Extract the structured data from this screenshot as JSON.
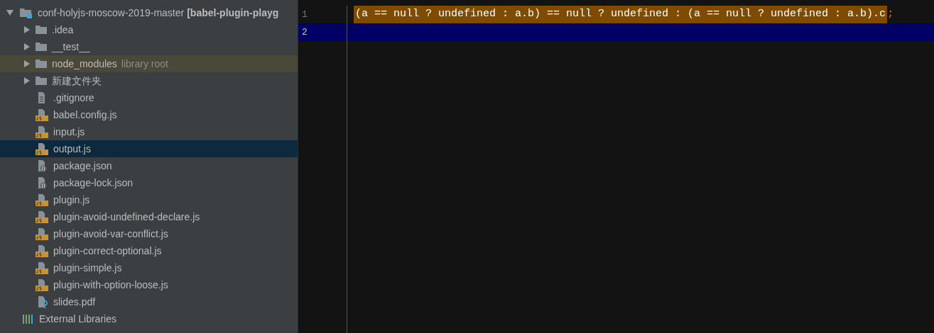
{
  "project_tree": {
    "root": {
      "label": "conf-holyjs-moscow-2019-master",
      "module": "[babel-plugin-playg",
      "expanded": true,
      "children": [
        {
          "kind": "folder",
          "label": ".idea",
          "expanded": false,
          "selected": false
        },
        {
          "kind": "folder",
          "label": "__test__",
          "expanded": false,
          "selected": false
        },
        {
          "kind": "folder",
          "label": "node_modules",
          "expanded": false,
          "selected": false,
          "note": "library root"
        },
        {
          "kind": "folder",
          "label": "新建文件夹",
          "expanded": false,
          "selected": false
        },
        {
          "kind": "text",
          "label": ".gitignore",
          "selected": false
        },
        {
          "kind": "js",
          "label": "babel.config.js",
          "selected": false
        },
        {
          "kind": "js",
          "label": "input.js",
          "selected": false
        },
        {
          "kind": "js",
          "label": "output.js",
          "selected": true
        },
        {
          "kind": "json",
          "label": "package.json",
          "selected": false
        },
        {
          "kind": "json",
          "label": "package-lock.json",
          "selected": false
        },
        {
          "kind": "js",
          "label": "plugin.js",
          "selected": false
        },
        {
          "kind": "js",
          "label": "plugin-avoid-undefined-declare.js",
          "selected": false
        },
        {
          "kind": "js",
          "label": "plugin-avoid-var-conflict.js",
          "selected": false
        },
        {
          "kind": "js",
          "label": "plugin-correct-optional.js",
          "selected": false
        },
        {
          "kind": "js",
          "label": "plugin-simple.js",
          "selected": false
        },
        {
          "kind": "js",
          "label": "plugin-with-option-loose.js",
          "selected": false
        },
        {
          "kind": "unknown",
          "label": "slides.pdf",
          "selected": false
        }
      ]
    },
    "external_libraries": {
      "label": "External Libraries"
    }
  },
  "editor": {
    "lines": [
      {
        "number": "1",
        "code": "(a == null ? undefined : a.b) == null ? undefined : (a == null ? undefined : a.b).c",
        "trailing": ";",
        "highlighted": true,
        "selected": false
      },
      {
        "number": "2",
        "selected": true
      }
    ]
  }
}
